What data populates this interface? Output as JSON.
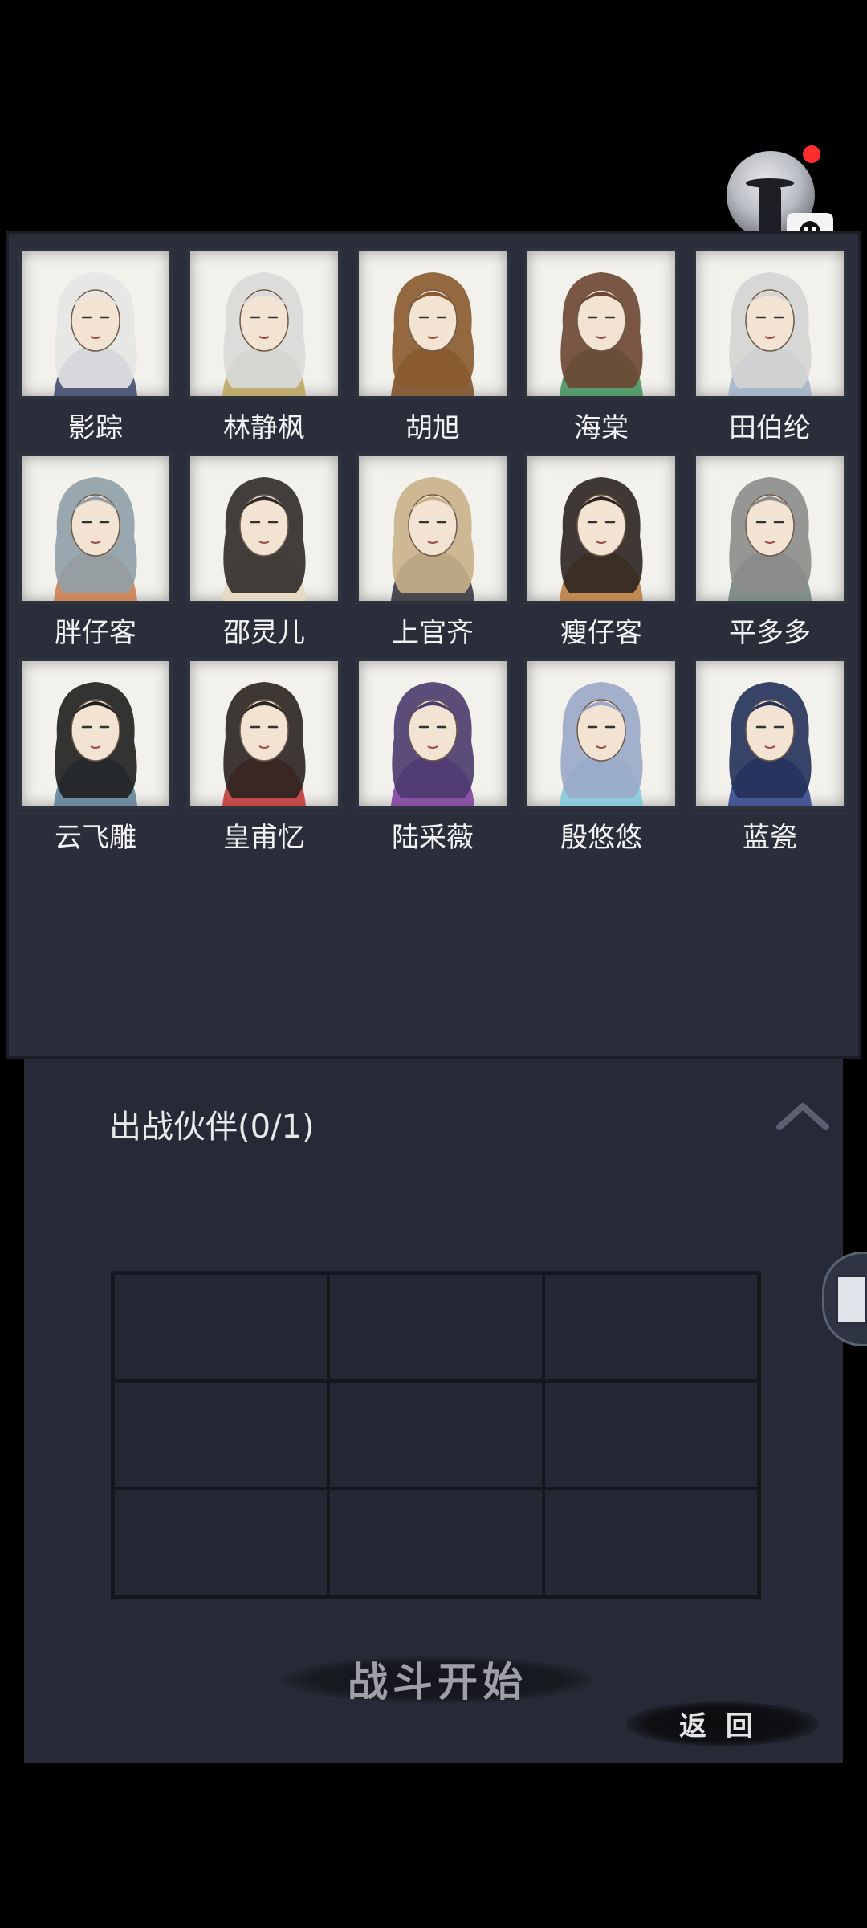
{
  "characters": [
    {
      "name": "影踪",
      "hair": "#e6e6e6",
      "robe": "#3a4468"
    },
    {
      "name": "林静枫",
      "hair": "#d9d9d9",
      "robe": "#b9a35a"
    },
    {
      "name": "胡旭",
      "hair": "#8a5a2e",
      "robe": "#7a4a22"
    },
    {
      "name": "海棠",
      "hair": "#6b4632",
      "robe": "#3e8f5a"
    },
    {
      "name": "田伯纶",
      "hair": "#d4d4d4",
      "robe": "#9fb0c6"
    },
    {
      "name": "胖仔客",
      "hair": "#8fa0a8",
      "robe": "#c9794a"
    },
    {
      "name": "邵灵儿",
      "hair": "#2e2a28",
      "robe": "#e8d8c0"
    },
    {
      "name": "上官齐",
      "hair": "#c9b18a",
      "robe": "#2e2e3a"
    },
    {
      "name": "瘦仔客",
      "hair": "#2c2420",
      "robe": "#b87a3a"
    },
    {
      "name": "平多多",
      "hair": "#8c8c8c",
      "robe": "#6e7f7a"
    },
    {
      "name": "云飞雕",
      "hair": "#1e1e1e",
      "robe": "#5a7c96"
    },
    {
      "name": "皇甫忆",
      "hair": "#2a2420",
      "robe": "#c03030"
    },
    {
      "name": "陆采薇",
      "hair": "#4a3a6e",
      "robe": "#7a3a9a"
    },
    {
      "name": "殷悠悠",
      "hair": "#9aa8c8",
      "robe": "#7ec8d8"
    },
    {
      "name": "蓝瓷",
      "hair": "#23305a",
      "robe": "#2a3f8a"
    }
  ],
  "lineup": {
    "title": "出战伙伴(0/1)"
  },
  "buttons": {
    "start": "战斗开始",
    "back": "返 回"
  },
  "colors": {
    "panel": "#2a2e3a",
    "background": "#000000",
    "badge": "#ff2e2e"
  }
}
